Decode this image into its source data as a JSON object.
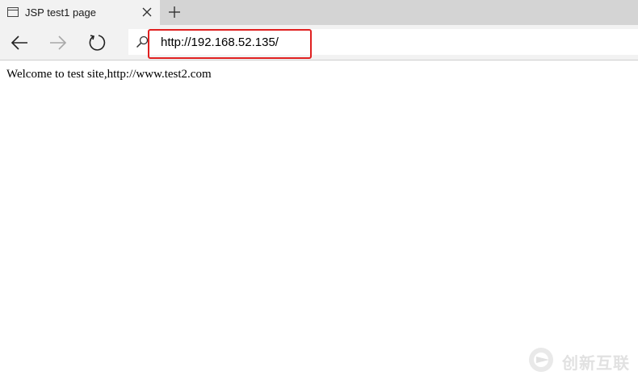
{
  "tab": {
    "title": "JSP test1 page"
  },
  "address_bar": {
    "url": "http://192.168.52.135/"
  },
  "page": {
    "text": "Welcome to test site,http://www.test2.com"
  },
  "watermark": {
    "text": "创新互联"
  },
  "colors": {
    "highlight": "#e02020",
    "tabstrip": "#d4d4d4",
    "toolbar": "#f2f2f2"
  }
}
